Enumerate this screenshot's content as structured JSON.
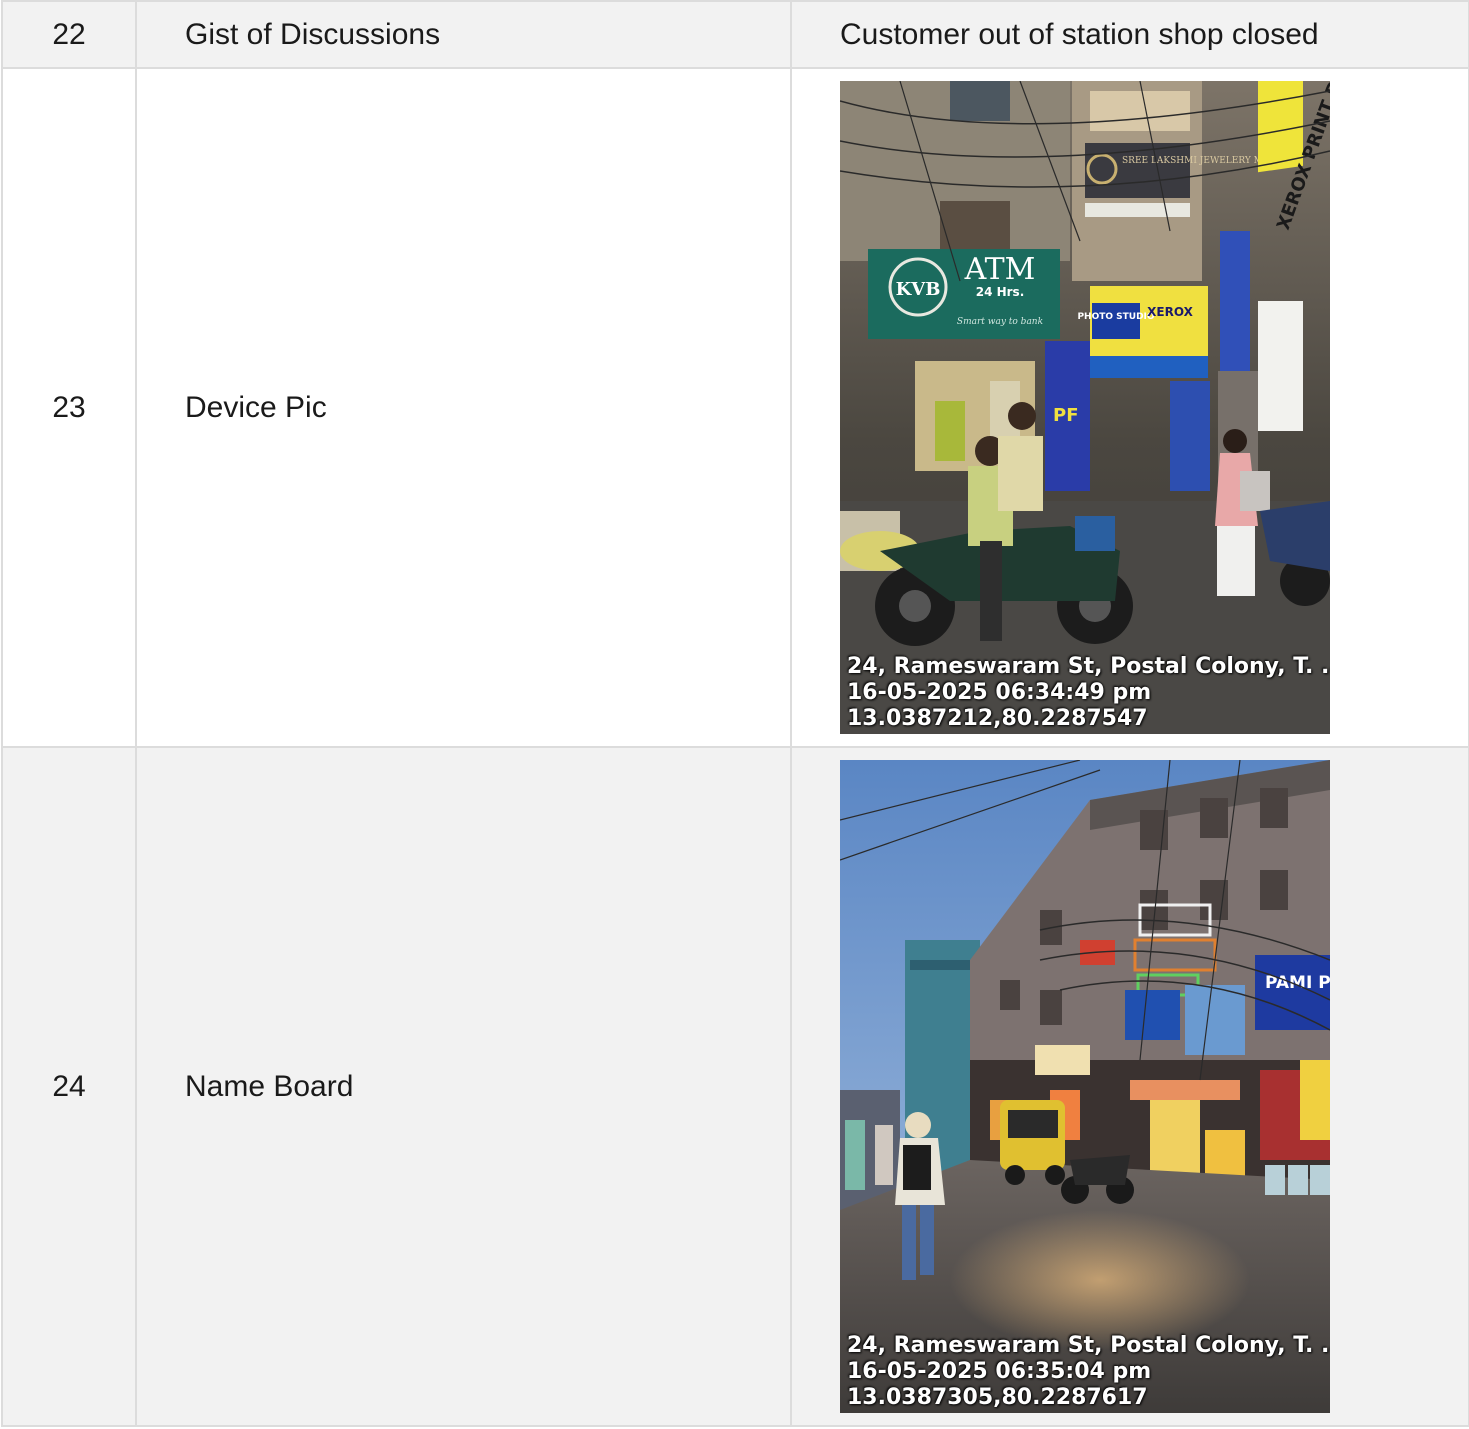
{
  "rows": [
    {
      "num": "22",
      "label": "Gist of Discussions",
      "value": "Customer out of station shop closed"
    },
    {
      "num": "23",
      "label": "Device Pic",
      "photo": {
        "signs": {
          "kvb": "KVB",
          "atm": "ATM",
          "atm_hours": "24 Hrs.",
          "tagline": "Smart way to bank",
          "jewelry": "SREE LAKSHMI JEWELERY MART",
          "photo_studio": "PHOTO STUDIO",
          "xerox": "XEROX",
          "pf": "PF",
          "vertical": "XEROX PRINT DTP"
        },
        "stamp": [
          "24, Rameswaram St, Postal Colony, T. ...",
          "16-05-2025 06:34:49 pm",
          "13.0387212,80.2287547"
        ]
      }
    },
    {
      "num": "24",
      "label": "Name Board",
      "photo": {
        "signs": {
          "pharmacy": "PAMI PHARM"
        },
        "stamp": [
          "24, Rameswaram St, Postal Colony, T. ...",
          "16-05-2025 06:35:04 pm",
          "13.0387305,80.2287617"
        ]
      }
    }
  ]
}
